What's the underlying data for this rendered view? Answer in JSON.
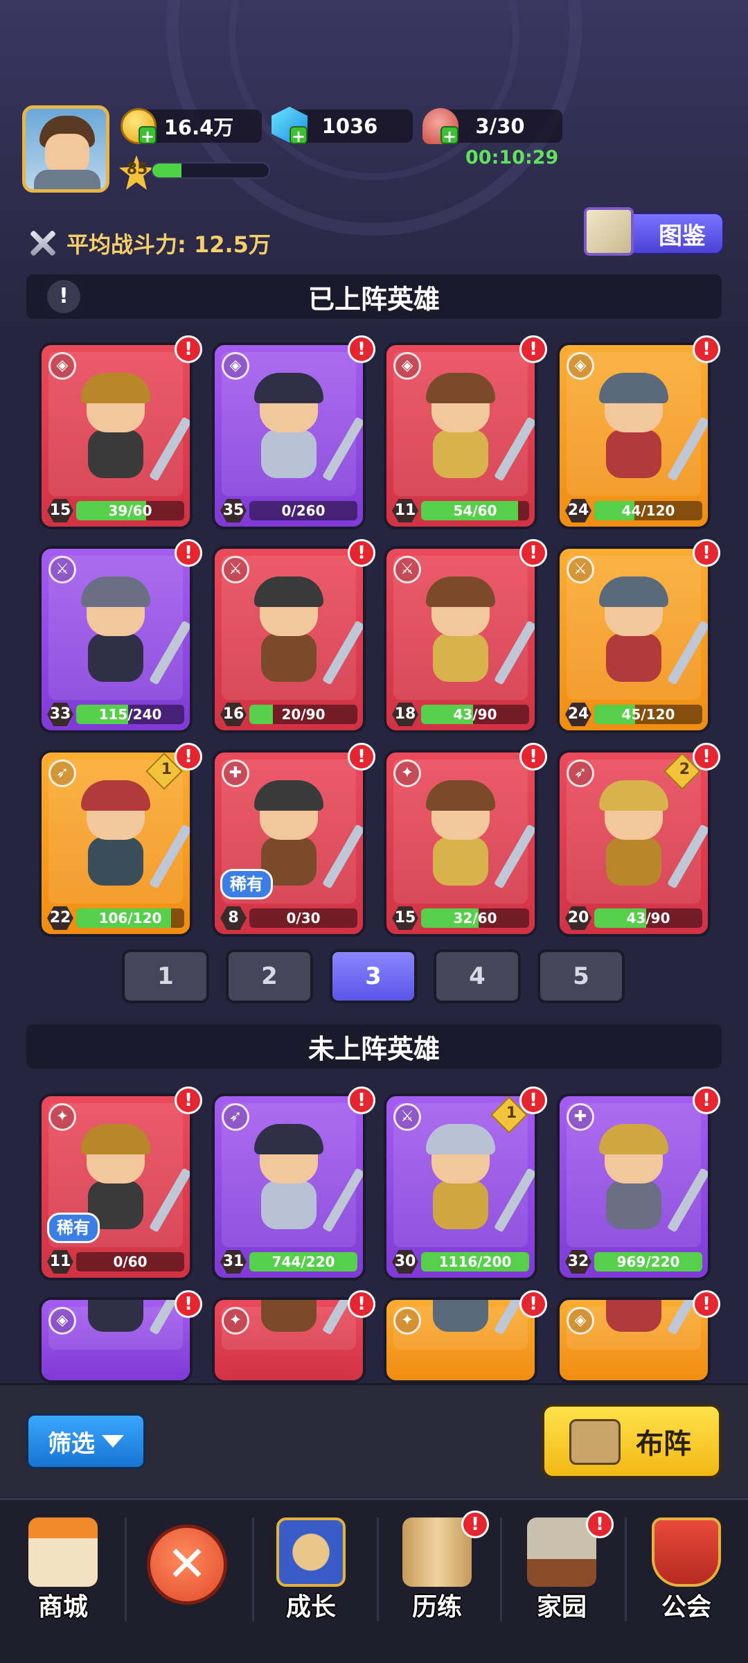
{
  "header": {
    "gold": "16.4万",
    "gems": "1036",
    "stamina": "3/30",
    "stamina_timer": "00:10:29",
    "player_level": "85",
    "xp_progress": 0.25,
    "avg_power": "平均战斗力: 12.5万",
    "codex_label": "图鉴"
  },
  "deployed": {
    "title": "已上阵英雄",
    "heroes": [
      {
        "rarity": "red",
        "class": "shield-icon",
        "level": "15",
        "progress": "39/60",
        "fill": 0.65
      },
      {
        "rarity": "purple",
        "class": "shield-icon",
        "level": "35",
        "progress": "0/260",
        "fill": 0
      },
      {
        "rarity": "red",
        "class": "shield-icon",
        "level": "11",
        "progress": "54/60",
        "fill": 0.9
      },
      {
        "rarity": "orange",
        "class": "shield-icon",
        "level": "24",
        "progress": "44/120",
        "fill": 0.37
      },
      {
        "rarity": "purple",
        "class": "sword-icon",
        "level": "33",
        "progress": "115/240",
        "fill": 0.48
      },
      {
        "rarity": "red",
        "class": "sword-icon",
        "level": "16",
        "progress": "20/90",
        "fill": 0.22
      },
      {
        "rarity": "red",
        "class": "sword-icon",
        "level": "18",
        "progress": "43/90",
        "fill": 0.48
      },
      {
        "rarity": "orange",
        "class": "sword-icon",
        "level": "24",
        "progress": "45/120",
        "fill": 0.38
      },
      {
        "rarity": "orange",
        "class": "bow-icon",
        "level": "22",
        "progress": "106/120",
        "fill": 0.88,
        "rank": "1"
      },
      {
        "rarity": "red",
        "class": "healer-icon",
        "level": "8",
        "progress": "0/30",
        "fill": 0,
        "rare": "稀有"
      },
      {
        "rarity": "red",
        "class": "staff-icon",
        "level": "15",
        "progress": "32/60",
        "fill": 0.53
      },
      {
        "rarity": "red",
        "class": "bow-icon",
        "level": "20",
        "progress": "43/90",
        "fill": 0.48,
        "rank": "2"
      }
    ]
  },
  "pagination": [
    "1",
    "2",
    "3",
    "4",
    "5"
  ],
  "active_page": "3",
  "undeployed": {
    "title": "未上阵英雄",
    "heroes": [
      {
        "rarity": "red",
        "class": "staff-icon",
        "level": "11",
        "progress": "0/60",
        "fill": 0,
        "rare": "稀有"
      },
      {
        "rarity": "purple",
        "class": "bow-icon",
        "level": "31",
        "progress": "744/220",
        "fill": 1
      },
      {
        "rarity": "purple",
        "class": "sword-icon",
        "level": "30",
        "progress": "1116/200",
        "fill": 1,
        "rank": "1"
      },
      {
        "rarity": "purple",
        "class": "healer-icon",
        "level": "32",
        "progress": "969/220",
        "fill": 1
      },
      {
        "rarity": "purple",
        "class": "shield-icon"
      },
      {
        "rarity": "red",
        "class": "staff-icon"
      },
      {
        "rarity": "orange",
        "class": "staff-icon"
      },
      {
        "rarity": "orange",
        "class": "shield-icon"
      }
    ]
  },
  "controls": {
    "filter_label": "筛选",
    "formation_label": "布阵"
  },
  "nav": {
    "shop": "商城",
    "growth": "成长",
    "trials": "历练",
    "home": "家园",
    "guild": "公会"
  },
  "colors": {
    "red": "#e0404f",
    "purple": "#9350e6",
    "orange": "#f69c22",
    "progress_green": "#56d04a",
    "accent_blue": "#6a64f5"
  }
}
